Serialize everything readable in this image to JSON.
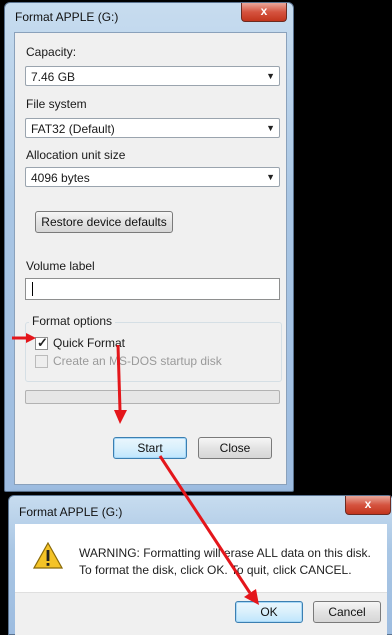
{
  "format_window": {
    "title": "Format APPLE (G:)",
    "close_glyph": "x",
    "capacity": {
      "label": "Capacity:",
      "value": "7.46 GB"
    },
    "file_system": {
      "label": "File system",
      "value": "FAT32 (Default)"
    },
    "allocation": {
      "label": "Allocation unit size",
      "value": "4096 bytes"
    },
    "restore_label": "Restore device defaults",
    "volume_label": {
      "label": "Volume label",
      "value": ""
    },
    "format_options": {
      "legend": "Format options",
      "quick_format": {
        "label": "Quick Format",
        "checked": true
      },
      "msdos": {
        "label": "Create an MS-DOS startup disk",
        "checked": false,
        "disabled": true
      }
    },
    "progress": 0,
    "start_label": "Start",
    "close_label": "Close"
  },
  "warning_dialog": {
    "title": "Format APPLE (G:)",
    "close_glyph": "x",
    "icon": "warning-icon",
    "line1": "WARNING: Formatting will erase ALL data on this disk.",
    "line2": "To format the disk, click OK. To quit, click CANCEL.",
    "ok_label": "OK",
    "cancel_label": "Cancel"
  },
  "annotation_color": "#e4161b"
}
